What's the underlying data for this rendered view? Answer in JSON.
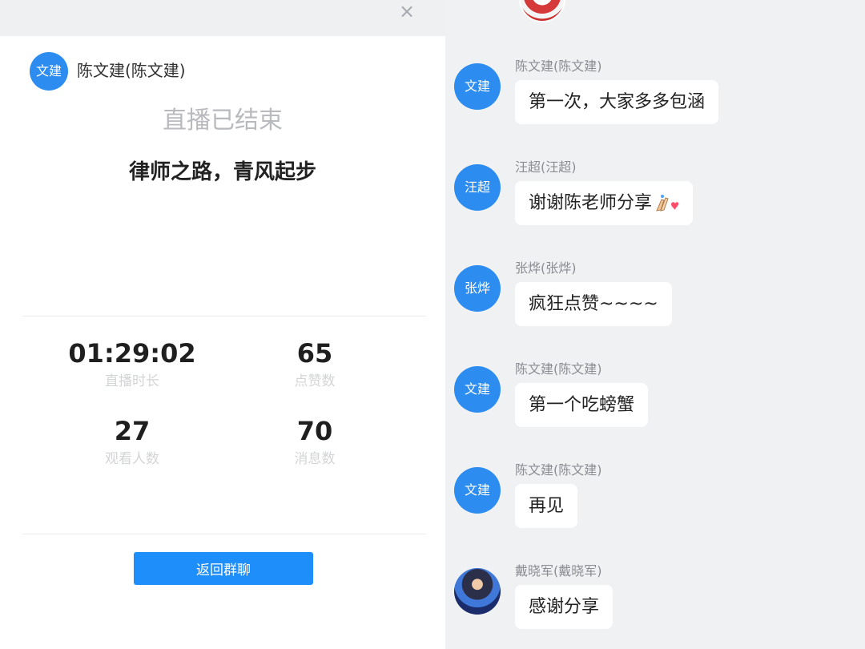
{
  "left": {
    "close_glyph": "×",
    "host": {
      "avatar_text": "文建",
      "name": "陈文建(陈文建)"
    },
    "status": "直播已结束",
    "title": "律师之路，青风起步",
    "stats": [
      {
        "value": "01:29:02",
        "label": "直播时长"
      },
      {
        "value": "65",
        "label": "点赞数"
      },
      {
        "value": "27",
        "label": "观看人数"
      },
      {
        "value": "70",
        "label": "消息数"
      }
    ],
    "back_button": "返回群聊"
  },
  "right": {
    "messages": [
      {
        "avatar_text": "文建",
        "sender": "陈文建(陈文建)",
        "text": "第一次，大家多多包涵"
      },
      {
        "avatar_text": "汪超",
        "sender": "汪超(汪超)",
        "text": "谢谢陈老师分享",
        "emoji": "applause-heart-icon"
      },
      {
        "avatar_text": "张烨",
        "sender": "张烨(张烨)",
        "text": "疯狂点赞~~~~"
      },
      {
        "avatar_text": "文建",
        "sender": "陈文建(陈文建)",
        "text": "第一个吃螃蟹"
      },
      {
        "avatar_text": "文建",
        "sender": "陈文建(陈文建)",
        "text": "再见"
      },
      {
        "avatar_text": "",
        "sender": "戴晓军(戴晓军)",
        "text": "感谢分享",
        "photo": true
      }
    ]
  },
  "colors": {
    "accent": "#1e8efa",
    "avatar": "#2d8cf0",
    "muted": "#b8babd"
  }
}
